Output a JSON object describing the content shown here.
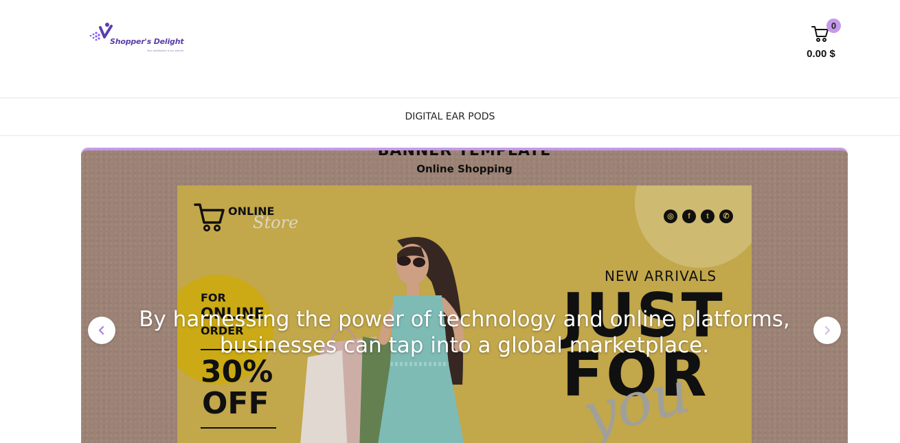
{
  "header": {
    "logo": {
      "name": "Shopper's Delight",
      "tagline": "Your satisfaction is our priority"
    },
    "cart": {
      "count": "0",
      "total": "0.00 $"
    }
  },
  "nav": {
    "items": [
      {
        "label": "DIGITAL EAR PODS"
      }
    ]
  },
  "slider": {
    "banner_heading": "BANNER TEMPLATE",
    "banner_subheading": "Online Shopping",
    "poster": {
      "store_online": "ONLINE",
      "store_script": "Store",
      "for_line": "FOR",
      "online_line": "ONLINE",
      "order_line": "ORDER",
      "discount_value": "30%",
      "discount_word": "OFF",
      "new_arrivals": "NEW ARRIVALS",
      "just": "JUST",
      "for_big": "FOR",
      "you": "you",
      "socials": [
        "instagram-icon",
        "facebook-icon",
        "twitter-icon",
        "whatsapp-icon"
      ]
    },
    "caption_line1": "By harnessing the power of technology and online platforms,",
    "caption_line2": "businesses can tap into a global marketplace."
  },
  "colors": {
    "accent": "#c49ae8",
    "banner_bg": "#a58a7c",
    "poster_bg": "#cdb050"
  }
}
